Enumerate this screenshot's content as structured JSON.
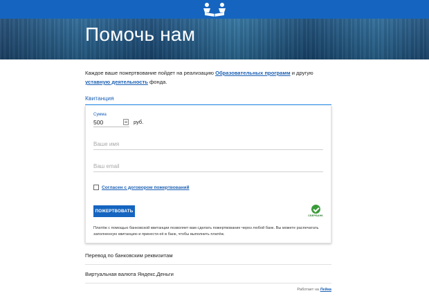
{
  "header": {
    "logo_icon": "open-book-people-icon",
    "brand_color": "#1565c0"
  },
  "hero": {
    "title": "Помочь нам"
  },
  "intro": {
    "text_before": "Каждое ваше пожертвование пойдет на реализацию ",
    "link1": "Образовательных программ",
    "text_middle": " и другую ",
    "link2": "уставную деятельность",
    "text_after": " фонда."
  },
  "receipt_section": {
    "title": "Квитанция",
    "sum_label": "Сумма",
    "sum_value": "500",
    "currency": "руб.",
    "name_placeholder": "Ваше имя",
    "email_placeholder": "Ваш email",
    "agreement_label": "Согласен с договором пожертвований",
    "donate_button": "ПОЖЕРТВОВАТЬ",
    "bank_logo_text": "СБЕРБАНК",
    "note": "Платёж с помощью банковской квитанции позволяет вам сделать пожертвование через любой банк. Вы можете распечатать заполненную квитанцию и принести её в банк, чтобы выполнить платёж."
  },
  "options": {
    "bank_transfer": "Перевод по банковским реквизитам",
    "yandex_money": "Виртуальная валюта Яндекс.Деньги"
  },
  "footer": {
    "powered_text": "Работает на ",
    "powered_link": "Лейка"
  }
}
